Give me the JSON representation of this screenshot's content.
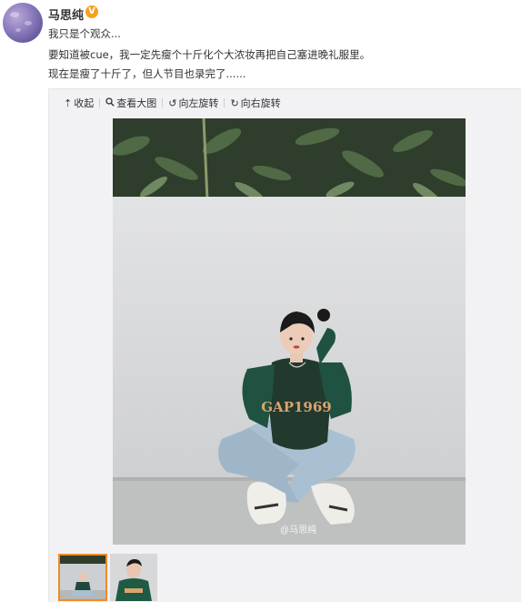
{
  "post": {
    "author": "马思纯",
    "verified_badge": "V",
    "lines": [
      "我只是个观众...",
      "要知道被cue，我一定先瘦个十斤化个大浓妆再把自己塞进晚礼服里。",
      "现在是瘦了十斤了，但人节目也录完了......"
    ]
  },
  "toolbar": {
    "collapse": "收起",
    "view_large": "查看大图",
    "rotate_left": "向左旋转",
    "rotate_right": "向右旋转"
  },
  "photo": {
    "sweater_text": "GAP1969",
    "watermark": "@马思纯"
  },
  "thumbnails": {
    "count": 2,
    "selected_index": 0
  },
  "colors": {
    "badge": "#f4a21d",
    "selected_border": "#f08a24"
  }
}
